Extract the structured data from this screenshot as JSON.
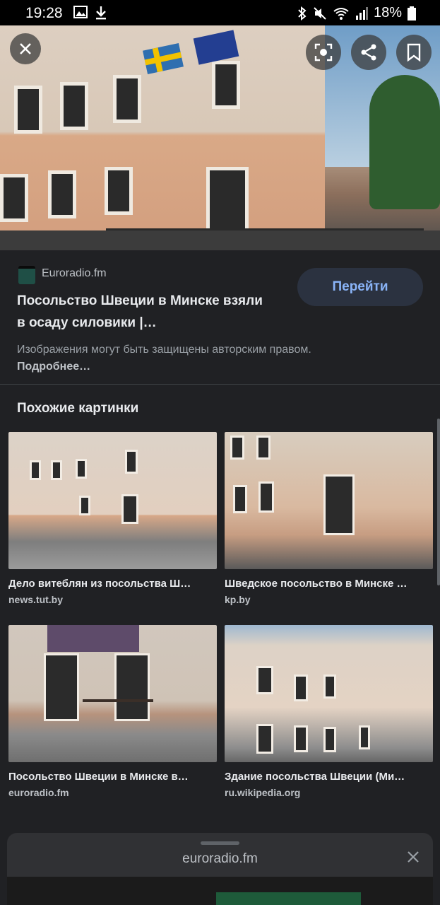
{
  "status_bar": {
    "time": "19:28",
    "battery": "18%"
  },
  "hero": {
    "close_label": "close",
    "lens_label": "lens",
    "share_label": "share",
    "bookmark_label": "bookmark"
  },
  "source": {
    "site": "Euroradio.fm",
    "title": "Посольство Швеции в Минске взяли в осаду силовики |…",
    "open_button": "Перейти",
    "copyright_text": "Изображения могут быть защищены авторским правом.",
    "more_link": "Подробнее…"
  },
  "similar": {
    "heading": "Похожие картинки",
    "items": [
      {
        "caption": "Дело витеблян из посольства Ш…",
        "site": "news.tut.by"
      },
      {
        "caption": "Шведское посольство в Минске …",
        "site": "kp.by"
      },
      {
        "caption": "Посольство Швеции в Минске в…",
        "site": "euroradio.fm"
      },
      {
        "caption": "Здание посольства Швеции (Ми…",
        "site": "ru.wikipedia.org"
      }
    ]
  },
  "bottom_sheet": {
    "title": "euroradio.fm"
  },
  "colors": {
    "background": "#202124",
    "accent": "#8ab4f8",
    "button_bg": "#2b3240"
  }
}
